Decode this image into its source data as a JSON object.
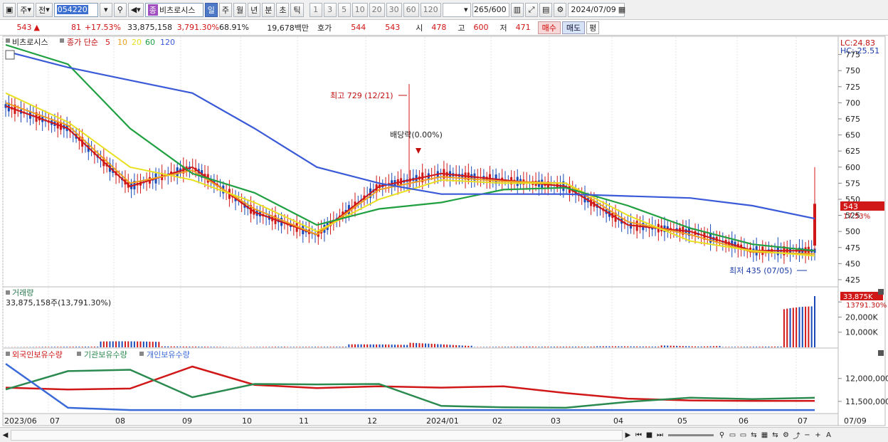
{
  "toolbar": {
    "market": "주",
    "prev": "전",
    "code": "054220",
    "name": "비츠로시스",
    "name_badge": "종",
    "periods": [
      "일",
      "주",
      "월",
      "년",
      "분",
      "초",
      "틱"
    ],
    "selected_period": "일",
    "intervals": [
      "1",
      "3",
      "5",
      "10",
      "20",
      "30",
      "60",
      "120"
    ],
    "count": "265",
    "count_total": "/600",
    "date": "2024/07/09"
  },
  "quote": {
    "price": "543",
    "change": "81",
    "change_pct": "+17.53%",
    "volume": "33,875,158",
    "volume_ratio": "3,791.30%",
    "turnover": "68.91%",
    "amount": "19,678백만",
    "hoga_label": "호가",
    "ask": "544",
    "bid": "543",
    "open_label": "시",
    "open": "478",
    "high_label": "고",
    "high": "600",
    "low_label": "저",
    "low": "471",
    "buy": "매수",
    "sell": "매도",
    "eval": "평"
  },
  "price_panel": {
    "stock_tag": "비츠로시스",
    "legend_prefix": "종가 단순",
    "ma_periods": [
      "5",
      "10",
      "20",
      "60",
      "120"
    ],
    "ma_colors": [
      "#d01818",
      "#f0a020",
      "#e8e020",
      "#20a040",
      "#3a5ad8"
    ],
    "lc": "LC:24.83",
    "hc": "HC:-25.51",
    "price_tag": "543",
    "price_pct_tag": "17.53%",
    "high_annot": "최고 729 (12/21)",
    "low_annot": "최저 435 (07/05)",
    "div_annot": "배당락(0.00%)"
  },
  "volume_panel": {
    "title": "거래량",
    "value": "33,875,158주(13,791.30%)",
    "tag": "33,875K",
    "tag_pct": "13791.30%"
  },
  "holdings_panel": {
    "legends": [
      "외국인보유수량",
      "기관보유수량",
      "개인보유수량"
    ],
    "colors": [
      "#d01818",
      "#2a8a50",
      "#3a6ad8"
    ]
  },
  "x_labels": [
    "2023/06",
    "07",
    "08",
    "09",
    "10",
    "11",
    "12",
    "2024/01",
    "02",
    "03",
    "04",
    "05",
    "06",
    "07"
  ],
  "x_right_label": "07/09",
  "chart_data": [
    {
      "type": "line",
      "title": "비츠로시스",
      "x": [
        "2023/06",
        "07",
        "08",
        "09",
        "10",
        "11",
        "12",
        "2024/01",
        "02",
        "03",
        "04",
        "05",
        "06",
        "07"
      ],
      "y_ticks": [
        425,
        450,
        475,
        500,
        525,
        550,
        575,
        600,
        625,
        650,
        675,
        700,
        725,
        750,
        775
      ],
      "ylim": [
        415,
        800
      ],
      "series": [
        {
          "name": "5",
          "values": [
            695,
            660,
            570,
            600,
            530,
            495,
            570,
            590,
            580,
            570,
            510,
            500,
            470,
            470
          ]
        },
        {
          "name": "10",
          "values": [
            700,
            665,
            575,
            595,
            535,
            495,
            565,
            585,
            578,
            575,
            515,
            495,
            468,
            465
          ]
        },
        {
          "name": "20",
          "values": [
            715,
            670,
            600,
            580,
            545,
            500,
            550,
            580,
            575,
            575,
            525,
            485,
            470,
            462
          ]
        },
        {
          "name": "60",
          "values": [
            790,
            760,
            660,
            590,
            560,
            510,
            535,
            545,
            565,
            568,
            540,
            505,
            480,
            470
          ]
        },
        {
          "name": "120",
          "values": [
            780,
            755,
            735,
            715,
            660,
            600,
            575,
            558,
            558,
            558,
            555,
            552,
            540,
            520
          ]
        }
      ]
    },
    {
      "type": "bar",
      "title": "거래량",
      "x": [
        "2023/06",
        "07",
        "08",
        "09",
        "10",
        "11",
        "12",
        "2024/01",
        "02",
        "03",
        "04",
        "05",
        "06",
        "07"
      ],
      "y_ticks": [
        "10,000K",
        "20,000K",
        "30,000K"
      ],
      "values": [
        500,
        600,
        5000,
        900,
        700,
        500,
        2500,
        4800,
        800,
        600,
        900,
        2500,
        700,
        33875
      ]
    },
    {
      "type": "line",
      "title": "보유수량",
      "x": [
        "2023/06",
        "07",
        "08",
        "09",
        "10",
        "11",
        "12",
        "2024/01",
        "02",
        "03",
        "04",
        "05",
        "06",
        "07"
      ],
      "y_ticks": [
        "11,500,000",
        "12,000,000"
      ],
      "series": [
        {
          "name": "외국인보유수량",
          "values": [
            11800000,
            11760000,
            11780000,
            12260000,
            11860000,
            11790000,
            11830000,
            11800000,
            11830000,
            11680000,
            11560000,
            11520000,
            11510000,
            11510000
          ]
        },
        {
          "name": "기관보유수량",
          "values": [
            11760000,
            12160000,
            12190000,
            11590000,
            11880000,
            11870000,
            11880000,
            11400000,
            11370000,
            11360000,
            11490000,
            11580000,
            11550000,
            11580000
          ]
        },
        {
          "name": "개인보유수량",
          "values": [
            12320000,
            11360000,
            11310000,
            11310000,
            11310000,
            11310000,
            11310000,
            11310000,
            11310000,
            11310000,
            11310000,
            11310000,
            11310000,
            11310000
          ]
        }
      ]
    }
  ]
}
